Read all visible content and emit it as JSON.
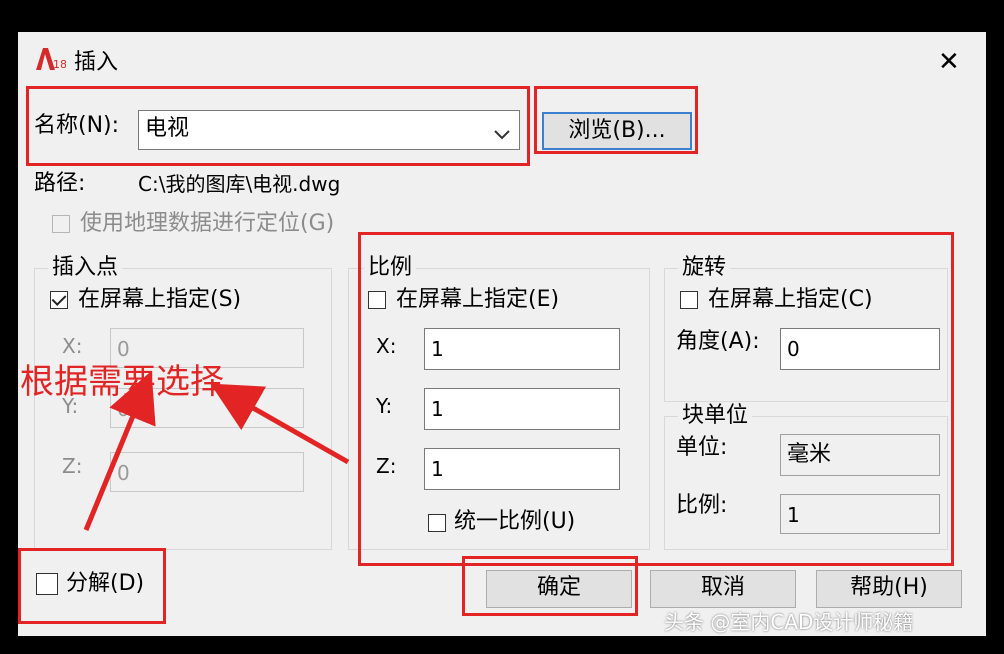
{
  "window": {
    "title": "插入",
    "close_symbol": "✕"
  },
  "name": {
    "label": "名称(N):",
    "value": "电视",
    "browse_label": "浏览(B)..."
  },
  "path": {
    "label": "路径:",
    "value": "C:\\我的图库\\电视.dwg"
  },
  "geo": {
    "label": "使用地理数据进行定位(G)"
  },
  "insertion_point": {
    "title": "插入点",
    "specify_label": "在屏幕上指定(S)",
    "specify_checked": true,
    "x_label": "X:",
    "x_value": "0",
    "y_label": "Y:",
    "y_value": "0",
    "z_label": "Z:",
    "z_value": "0"
  },
  "scale": {
    "title": "比例",
    "specify_label": "在屏幕上指定(E)",
    "x_label": "X:",
    "x_value": "1",
    "y_label": "Y:",
    "y_value": "1",
    "z_label": "Z:",
    "z_value": "1",
    "uniform_label": "统一比例(U)"
  },
  "rotation": {
    "title": "旋转",
    "specify_label": "在屏幕上指定(C)",
    "angle_label": "角度(A):",
    "angle_value": "0"
  },
  "block_unit": {
    "title": "块单位",
    "unit_label": "单位:",
    "unit_value": "毫米",
    "ratio_label": "比例:",
    "ratio_value": "1"
  },
  "explode": {
    "label": "分解(D)"
  },
  "buttons": {
    "ok": "确定",
    "cancel": "取消",
    "help": "帮助(H)"
  },
  "annotation": {
    "text": "根据需要选择"
  },
  "watermark": {
    "text": "头条 @室内CAD设计师秘籍"
  },
  "colors": {
    "highlight_red": "#e32424",
    "dialog_bg": "#f0f0f0"
  }
}
